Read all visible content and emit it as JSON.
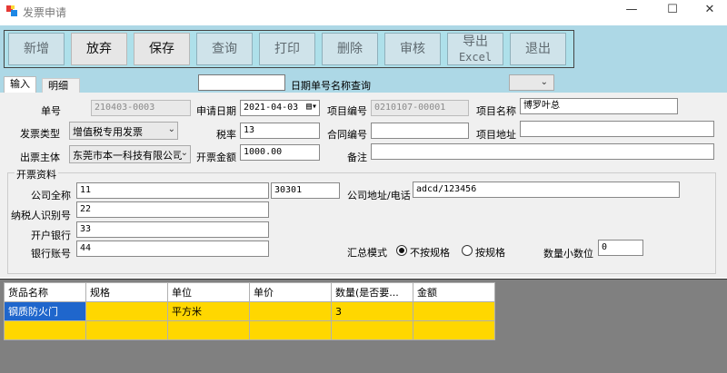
{
  "window": {
    "title": "发票申请",
    "min_glyph": "—",
    "max_glyph": "☐",
    "close_glyph": "✕"
  },
  "toolbar": {
    "buttons": [
      {
        "label": "新增"
      },
      {
        "label": "放弃",
        "active": true
      },
      {
        "label": "保存",
        "active": true
      },
      {
        "label": "查询"
      },
      {
        "label": "打印"
      },
      {
        "label": "删除"
      },
      {
        "label": "审核"
      },
      {
        "label": "导出",
        "label2": "Excel"
      },
      {
        "label": "退出"
      }
    ]
  },
  "tabs": {
    "input": "输入",
    "detail": "明细"
  },
  "search": {
    "value": "",
    "label": "日期单号名称查询",
    "select_value": ""
  },
  "form": {
    "doc_no_label": "单号",
    "doc_no": "210403-0003",
    "apply_date_label": "申请日期",
    "apply_date": "2021-04-03",
    "project_no_label": "项目编号",
    "project_no": "0210107-00001",
    "project_name_label": "项目名称",
    "project_name": "博罗叶总",
    "invoice_type_label": "发票类型",
    "invoice_type": "增值税专用发票",
    "tax_rate_label": "税率",
    "tax_rate": "13",
    "contract_no_label": "合同编号",
    "contract_no": "",
    "project_addr_label": "项目地址",
    "project_addr": "",
    "issuer_label": "出票主体",
    "issuer": "东莞市本一科技有限公司",
    "amount_label": "开票金额",
    "amount": "1000.00",
    "remark_label": "备注",
    "remark": ""
  },
  "billing": {
    "group_title": "开票资料",
    "company_label": "公司全称",
    "company": "11",
    "company_code": "30301",
    "addr_phone_label": "公司地址/电话",
    "addr_phone": "adcd/123456",
    "tax_id_label": "纳税人识别号",
    "tax_id": "22",
    "bank_label": "开户银行",
    "bank": "33",
    "account_label": "银行账号",
    "account": "44",
    "summary_mode_label": "汇总模式",
    "mode_no_spec": "不按规格",
    "mode_by_spec": "按规格",
    "mode_selected": "不按规格",
    "qty_decimals_label": "数量小数位",
    "qty_decimals": "0"
  },
  "grid": {
    "columns": [
      "货品名称",
      "规格",
      "单位",
      "单价",
      "数量(是否要...",
      "金额"
    ],
    "rows": [
      [
        "钢质防火门",
        "",
        "平方米",
        "",
        "3",
        ""
      ],
      [
        "",
        "",
        "",
        "",
        "",
        ""
      ]
    ]
  },
  "colors": {
    "toolbar_bg": "#add8e6",
    "row_bg": "#ffd700",
    "selected_cell": "#1f66cc",
    "grid_bg": "#808080"
  }
}
